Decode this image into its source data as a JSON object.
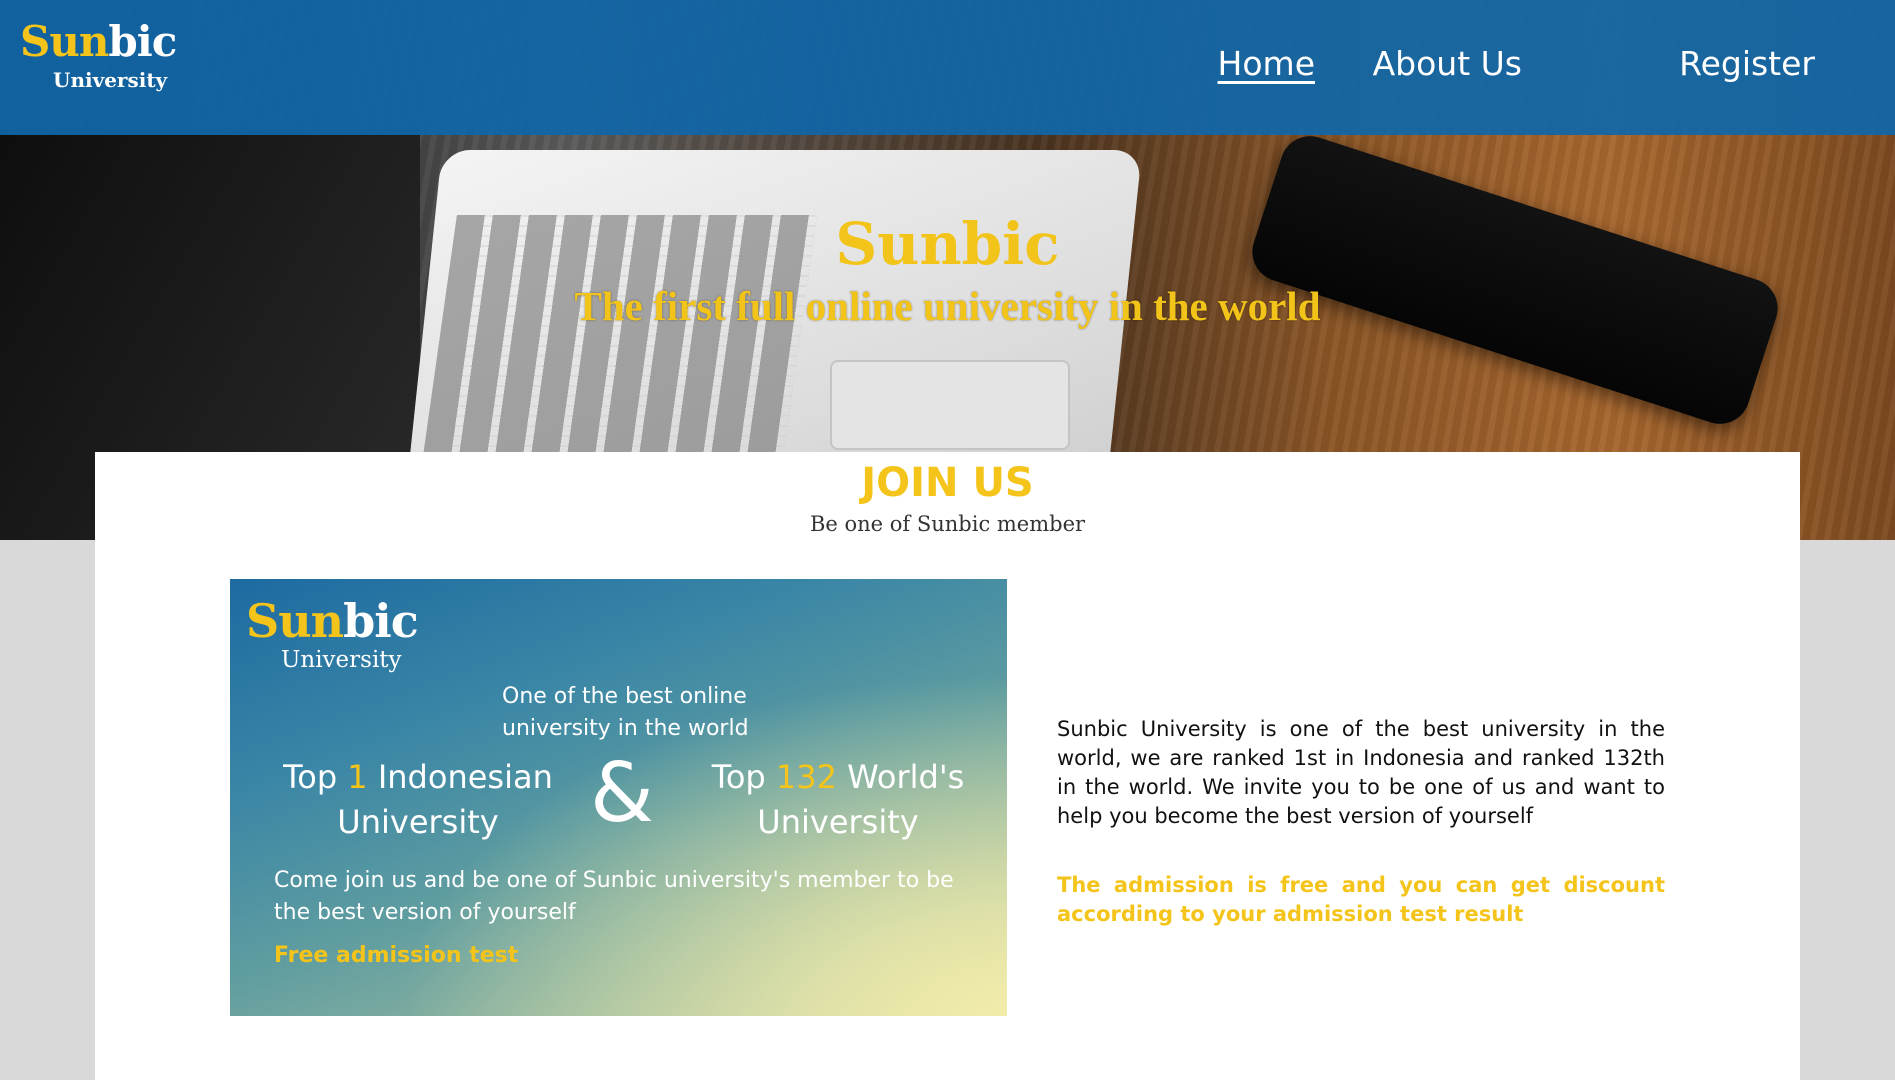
{
  "brand": {
    "name_part1": "Sun",
    "name_part2": "bic",
    "subtitle": "University"
  },
  "nav": {
    "items": [
      {
        "label": "Home",
        "active": true
      },
      {
        "label": "About Us",
        "active": false
      },
      {
        "label": "Register",
        "active": false
      }
    ]
  },
  "hero": {
    "title": "Sunbic",
    "subtitle": "The first full online university in the world"
  },
  "join": {
    "title": "JOIN US",
    "subtitle": "Be one of Sunbic member"
  },
  "promo": {
    "brand_part1": "Sun",
    "brand_part2": "bic",
    "brand_subtitle": "University",
    "tagline": "One of the best online university in the world",
    "rank_left": {
      "prefix": "Top ",
      "number": "1",
      "suffix": " Indonesian University"
    },
    "ampersand": "&",
    "rank_right": {
      "prefix": "Top ",
      "number": "132",
      "suffix": " World's University"
    },
    "invite": "Come join us and be one of Sunbic university's member to be the best version of yourself",
    "free_test": "Free admission test"
  },
  "description": {
    "text": "Sunbic University is one of the best university in the world, we are ranked 1st in Indonesia and ranked 132th in the world. We invite you to be one of us and want to help you become the best version of yourself",
    "admission": "The admission is free and you can get discount according to your admission test result"
  },
  "colors": {
    "header_blue": "#1066a8",
    "accent_yellow": "#f4c41a",
    "panel_bg": "#ffffff",
    "page_bg": "#d9d9d9"
  }
}
